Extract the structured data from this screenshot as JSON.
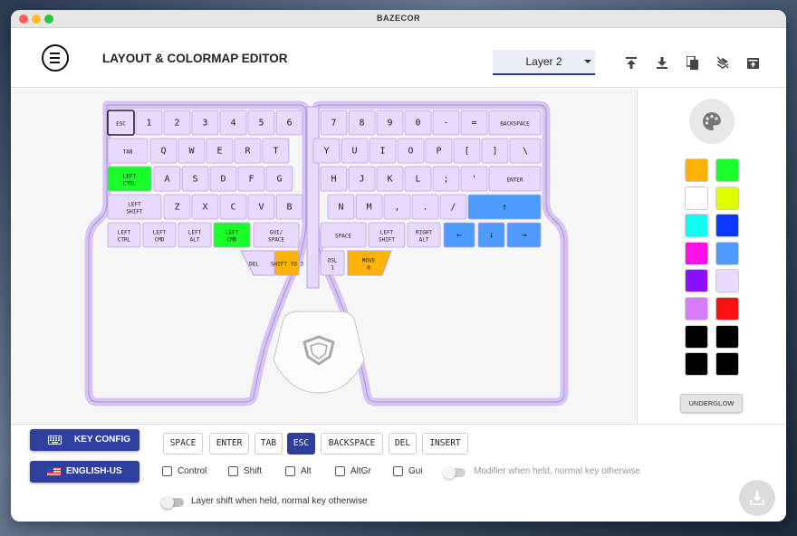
{
  "window": {
    "title": "BAZECOR"
  },
  "header": {
    "title": "LAYOUT & COLORMAP EDITOR",
    "layer": "Layer 2"
  },
  "toolbar": [
    {
      "icon": "export-icon"
    },
    {
      "icon": "import-icon"
    },
    {
      "icon": "copy-icon"
    },
    {
      "icon": "clear-layer-icon"
    },
    {
      "icon": "backup-icon"
    }
  ],
  "keyboard": {
    "left": [
      [
        "ESC",
        "1",
        "2",
        "3",
        "4",
        "5",
        "6"
      ],
      [
        "TAB",
        "Q",
        "W",
        "E",
        "R",
        "T"
      ],
      [
        "LEFT CTRL",
        "A",
        "S",
        "D",
        "F",
        "G"
      ],
      [
        "LEFT SHIFT",
        "Z",
        "X",
        "C",
        "V",
        "B"
      ],
      [
        "LEFT CTRL",
        "LEFT CMD",
        "LEFT ALT",
        "LEFT CMD",
        "GUI/ SPACE"
      ],
      [
        "DEL",
        "SHIFT TO 3"
      ]
    ],
    "right": [
      [
        "7",
        "8",
        "9",
        "0",
        "-",
        "=",
        "BACKSPACE"
      ],
      [
        "Y",
        "U",
        "I",
        "O",
        "P",
        "[",
        "]",
        "\\"
      ],
      [
        "H",
        "J",
        "K",
        "L",
        ";",
        "'",
        "ENTER"
      ],
      [
        "N",
        "M",
        ",",
        ".",
        "/",
        "↑"
      ],
      [
        "SPACE",
        "LEFT SHIFT",
        "RIGHT ALT",
        "←",
        "↓",
        "→"
      ],
      [
        "OSL 1",
        "MOVE 0"
      ]
    ]
  },
  "palette": {
    "colors": [
      "#ffb300",
      "#18ff2a",
      "#ffffff",
      "#dfff00",
      "#10fff0",
      "#0a38ff",
      "#ff10e8",
      "#4d9bff",
      "#8a10ff",
      "#ead9ff",
      "#d97bff",
      "#ff1010",
      "#000000",
      "#000000",
      "#000000",
      "#000000"
    ],
    "underglow_label": "UNDERGLOW"
  },
  "bottom": {
    "key_config_label": "KEY CONFIG",
    "language_label": "ENGLISH-US",
    "keys": [
      "SPACE",
      "ENTER",
      "TAB",
      "ESC",
      "BACKSPACE",
      "DEL",
      "INSERT"
    ],
    "selected_key": "ESC",
    "modifiers": [
      "Control",
      "Shift",
      "Alt",
      "AltGr",
      "Gui"
    ],
    "modifier_toggle_label": "Modifier when held, normal key otherwise",
    "layer_toggle_label": "Layer shift when held, normal key otherwise"
  },
  "colors": {
    "accent": "#2f3f9e",
    "key_default": "#ead9ff",
    "key_green": "#18ff2a",
    "key_blue": "#4d9bff",
    "key_orange": "#ffb300"
  }
}
